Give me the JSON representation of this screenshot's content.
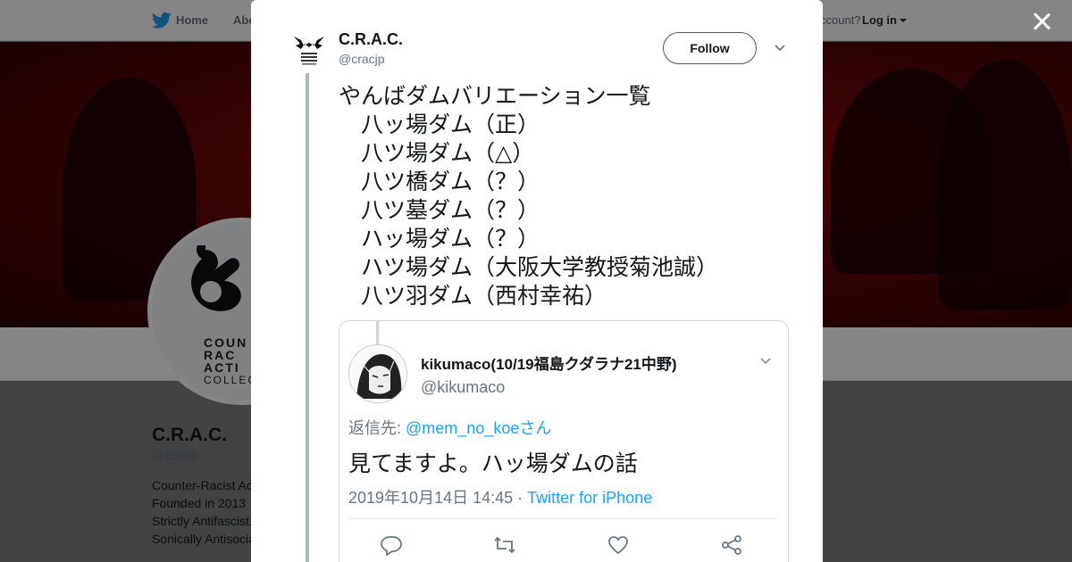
{
  "topbar": {
    "home_label": "Home",
    "about_label": "Abo",
    "account_text": "ccount?",
    "login_label": "Log in"
  },
  "profile": {
    "name": "C.R.A.C.",
    "handle": "@cracjp",
    "logo_lines": [
      "COUN",
      "RAC",
      "ACTI",
      "COLLEC"
    ],
    "bio": [
      "Counter-Racist Ac",
      "Founded in 2013",
      "Strictly Antifascist.",
      "Sonically Antisocia"
    ]
  },
  "tweet": {
    "author_name": "C.R.A.C.",
    "author_handle": "@cracjp",
    "follow_label": "Follow",
    "text": "やんばダムバリエーション一覧\n　八ッ場ダム（正）\n　八ツ場ダム（△）\n　八ツ橋ダム（？）\n　八ツ墓ダム（？）\n　ハッ場ダム（？）\n　ハツ場ダム（大阪大学教授菊池誠）\n　八ツ羽ダム（西村幸祐）"
  },
  "quoted": {
    "name": "kikumaco(10/19福島クダラナ21中野)",
    "handle": "@kikumaco",
    "reply_prefix": "返信先: ",
    "reply_to": "@mem_no_koeさん",
    "text": "見てますよ。ハッ場ダムの話",
    "date": "2019年10月14日 14:45 · ",
    "source": "Twitter for iPhone",
    "actions": [
      "reply-icon",
      "retweet-icon",
      "like-icon",
      "share-icon"
    ]
  },
  "colors": {
    "twitter_blue": "#1da1f2",
    "banner_red": "#b01010",
    "muted_text": "#657786"
  }
}
